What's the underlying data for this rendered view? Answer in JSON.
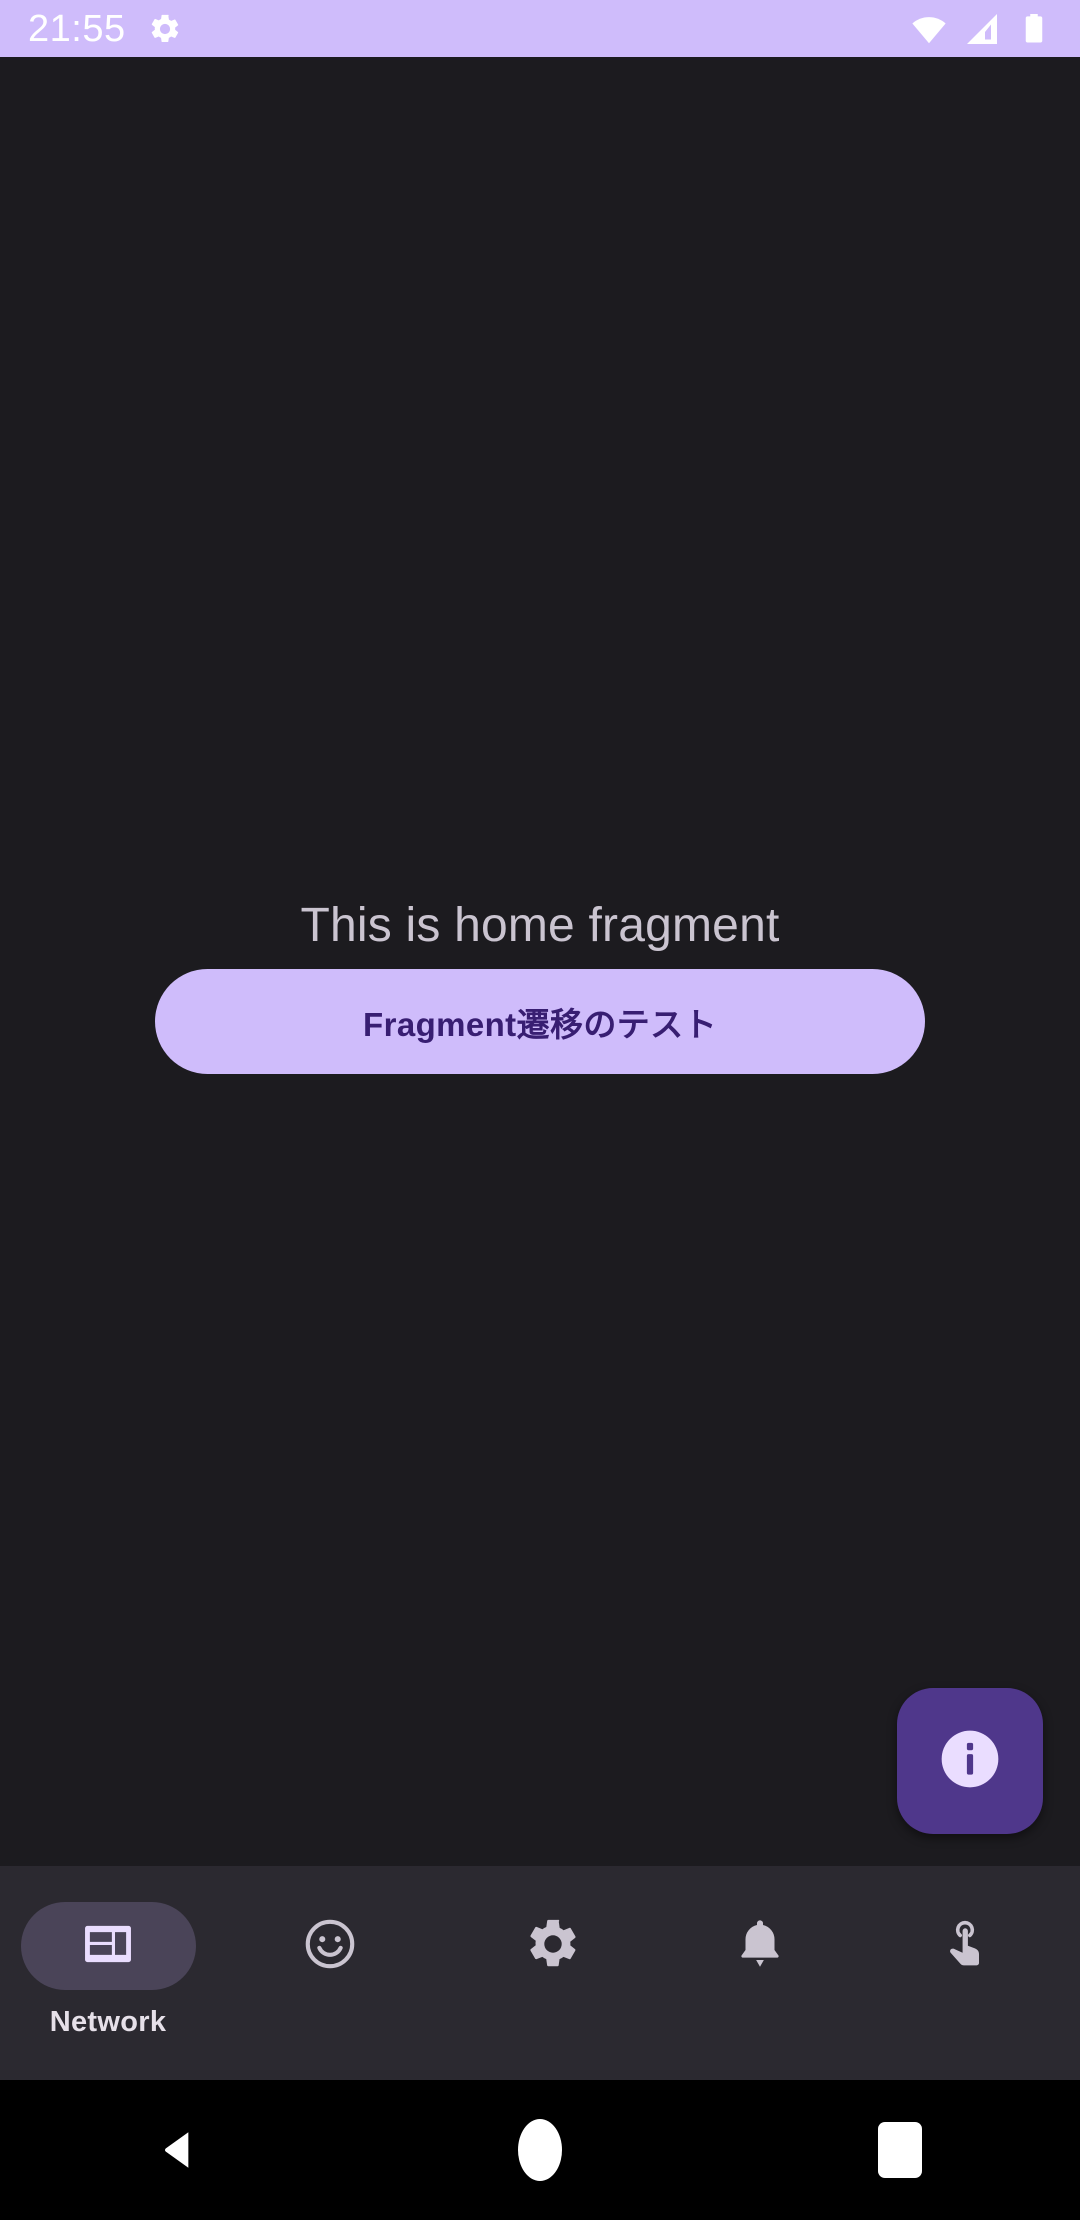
{
  "status_bar": {
    "clock": "21:55",
    "background_color": "#cfbcfb",
    "icons": [
      "gear-icon",
      "wifi-icon",
      "cellular-signal-icon",
      "battery-icon"
    ]
  },
  "content": {
    "background_color": "#1c1b1f",
    "home_text": "This is home fragment",
    "home_text_color": "#cac4d0",
    "button": {
      "label": "Fragment遷移のテスト",
      "background_color": "#cfbcfb",
      "text_color": "#381e72"
    },
    "fab": {
      "icon": "info-icon",
      "background_color": "#4f378b",
      "icon_color": "#eaddff"
    }
  },
  "bottom_nav": {
    "background_color": "#2b2930",
    "active_indicator_color": "#4a4458",
    "items": [
      {
        "label": "Network",
        "icon": "dashboard-icon",
        "active": true
      },
      {
        "label": "",
        "icon": "smiley-face-icon",
        "active": false
      },
      {
        "label": "",
        "icon": "gear-icon",
        "active": false
      },
      {
        "label": "",
        "icon": "bell-icon",
        "active": false
      },
      {
        "label": "",
        "icon": "touch-gesture-icon",
        "active": false
      }
    ]
  },
  "system_nav": {
    "background_color": "#000000",
    "buttons": [
      "back-button",
      "home-button",
      "recents-button"
    ]
  }
}
